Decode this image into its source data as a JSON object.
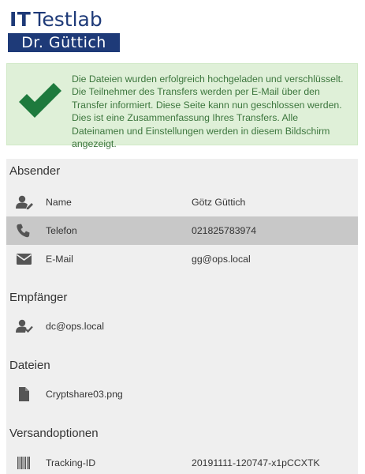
{
  "logo": {
    "it": "IT",
    "testlab": "Testlab",
    "subtitle": "Dr. Güttich"
  },
  "alert": {
    "message": "Die Dateien wurden erfolgreich hochgeladen und verschlüsselt. Die Teilnehmer des Transfers werden per E-Mail über den Transfer informiert. Diese Seite kann nun geschlossen werden. Dies ist eine Zusammenfassung Ihres Transfers. Alle Dateinamen und Einstellungen werden in diesem Bildschirm angezeigt.",
    "icon": "checkmark-icon",
    "color": "#3c763d",
    "background": "#dff0d8"
  },
  "sender": {
    "title": "Absender",
    "rows": [
      {
        "icon": "user-edit-icon",
        "label": "Name",
        "value": "Götz Güttich"
      },
      {
        "icon": "phone-icon",
        "label": "Telefon",
        "value": "021825783974"
      },
      {
        "icon": "envelope-icon",
        "label": "E-Mail",
        "value": "gg@ops.local"
      }
    ]
  },
  "recipients": {
    "title": "Empfänger",
    "rows": [
      {
        "icon": "user-check-icon",
        "label": "dc@ops.local"
      }
    ]
  },
  "files": {
    "title": "Dateien",
    "rows": [
      {
        "icon": "file-icon",
        "label": "Cryptshare03.png"
      }
    ]
  },
  "options": {
    "title": "Versandoptionen",
    "rows": [
      {
        "icon": "barcode-icon",
        "label": "Tracking-ID",
        "value": "20191111-120747-x1pCCXTK"
      }
    ]
  }
}
